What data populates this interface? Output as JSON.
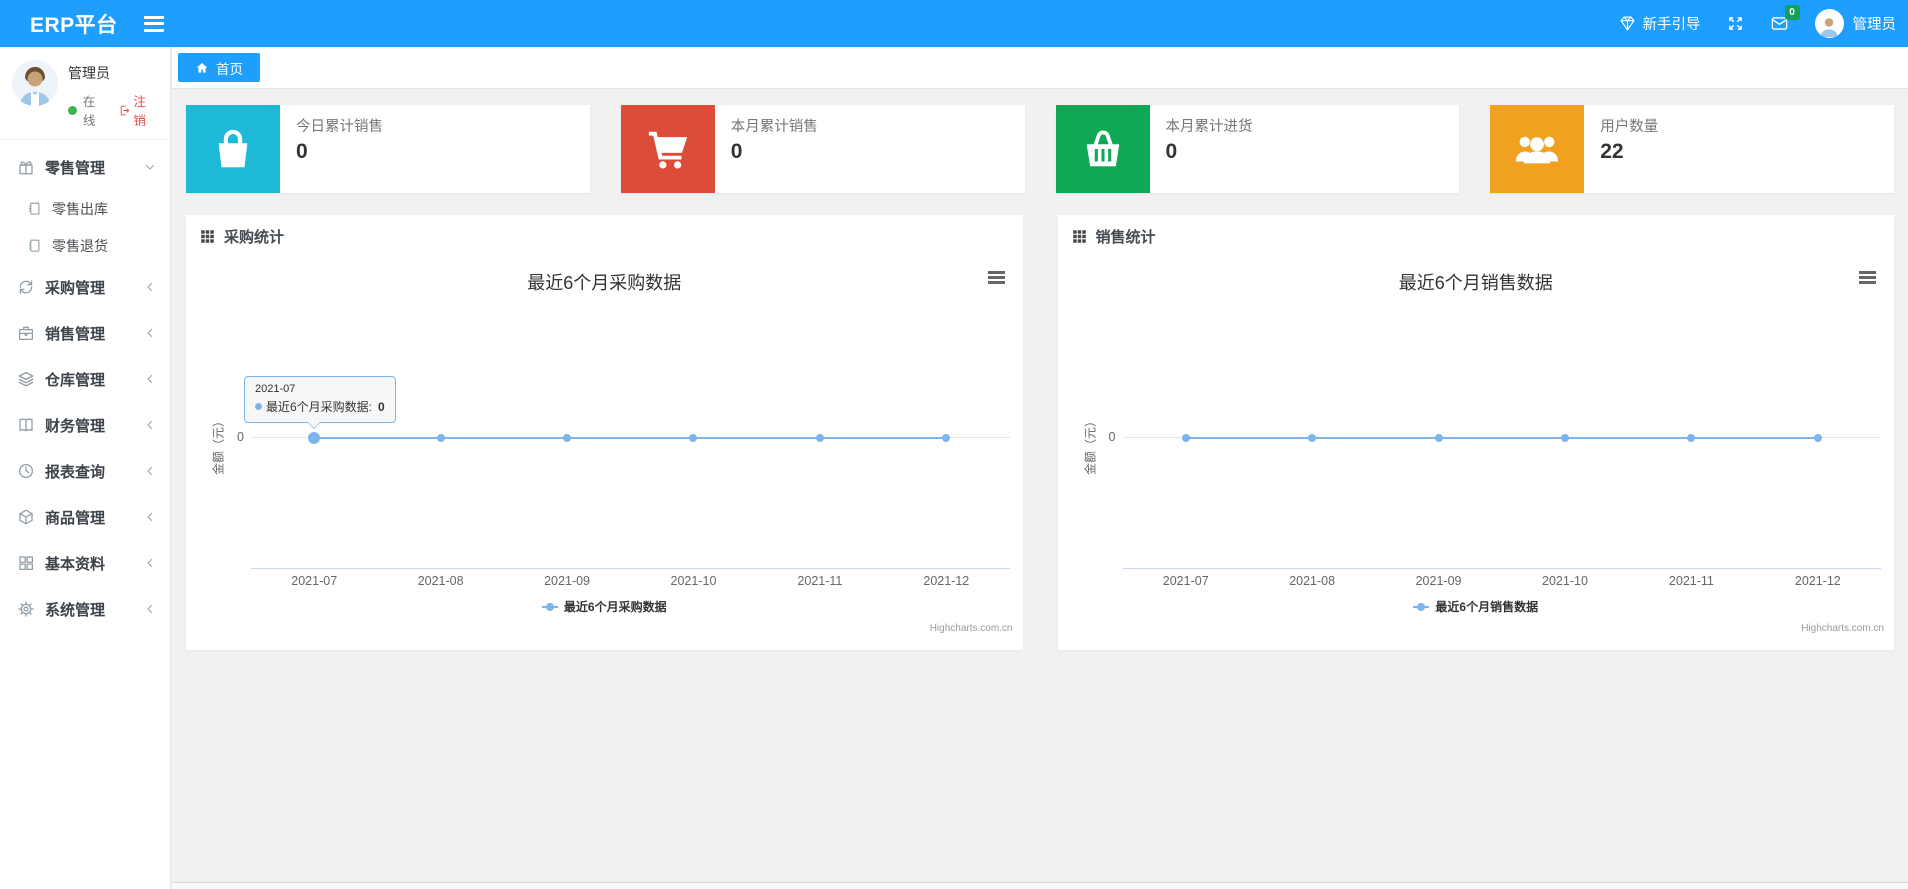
{
  "navbar": {
    "brand": "ERP平台",
    "menu_icon": "hamburger-icon",
    "right": {
      "guide_label": "新手引导",
      "guide_icon": "gem-icon",
      "fullscreen_icon": "fullscreen-icon",
      "mail_icon": "envelope-icon",
      "mail_badge": "0",
      "avatar_icon": "user-avatar",
      "username": "管理员"
    }
  },
  "sidebar": {
    "user": {
      "name": "管理员",
      "status_dot_color": "#3cb649",
      "status": "在线",
      "logout_icon": "logout-icon",
      "logout": "注销"
    },
    "menu": [
      {
        "label": "零售管理",
        "icon": "gift-icon",
        "state": "expanded",
        "children": [
          {
            "label": "零售出库",
            "icon": "notebook-icon"
          },
          {
            "label": "零售退货",
            "icon": "notebook-icon"
          }
        ]
      },
      {
        "label": "采购管理",
        "icon": "repeat-icon",
        "state": "collapsed"
      },
      {
        "label": "销售管理",
        "icon": "briefcase-icon",
        "state": "collapsed"
      },
      {
        "label": "仓库管理",
        "icon": "layers-icon",
        "state": "collapsed"
      },
      {
        "label": "财务管理",
        "icon": "open-book-icon",
        "state": "collapsed"
      },
      {
        "label": "报表查询",
        "icon": "clock-icon",
        "state": "collapsed"
      },
      {
        "label": "商品管理",
        "icon": "cube-icon",
        "state": "collapsed"
      },
      {
        "label": "基本资料",
        "icon": "grid-icon",
        "state": "collapsed"
      },
      {
        "label": "系统管理",
        "icon": "gear-icon",
        "state": "collapsed"
      }
    ]
  },
  "tabs": {
    "home": {
      "icon": "home-icon",
      "label": "首页"
    }
  },
  "stat_cards": [
    {
      "label": "今日累计销售",
      "value": "0",
      "color": "#1fb9d8",
      "icon": "shopping-bag-icon"
    },
    {
      "label": "本月累计销售",
      "value": "0",
      "color": "#dd4b39",
      "icon": "cart-icon"
    },
    {
      "label": "本月累计进货",
      "value": "0",
      "color": "#0fa956",
      "icon": "basket-icon"
    },
    {
      "label": "用户数量",
      "value": "22",
      "color": "#f0a11f",
      "icon": "users-icon"
    }
  ],
  "panels": [
    {
      "icon": "th-grid-icon",
      "title": "采购统计",
      "menu_icon": "chart-context-menu-icon"
    },
    {
      "icon": "th-grid-icon",
      "title": "销售统计",
      "menu_icon": "chart-context-menu-icon"
    }
  ],
  "chart_data": [
    {
      "type": "line",
      "title": "最近6个月采购数据",
      "categories": [
        "2021-07",
        "2021-08",
        "2021-09",
        "2021-10",
        "2021-11",
        "2021-12"
      ],
      "series": [
        {
          "name": "最近6个月采购数据",
          "values": [
            0,
            0,
            0,
            0,
            0,
            0
          ],
          "color": "#7cb5ec"
        }
      ],
      "xlabel": "",
      "ylabel": "金额（元）",
      "y_ticks": [
        "0"
      ],
      "ylim": [
        0,
        0
      ],
      "grid": true,
      "legend_position": "bottom",
      "credits": "Highcharts.com.cn",
      "tooltip": {
        "header": "2021-07",
        "series": "最近6个月采购数据:",
        "value": "0"
      }
    },
    {
      "type": "line",
      "title": "最近6个月销售数据",
      "categories": [
        "2021-07",
        "2021-08",
        "2021-09",
        "2021-10",
        "2021-11",
        "2021-12"
      ],
      "series": [
        {
          "name": "最近6个月销售数据",
          "values": [
            0,
            0,
            0,
            0,
            0,
            0
          ],
          "color": "#7cb5ec"
        }
      ],
      "xlabel": "",
      "ylabel": "金额（元）",
      "y_ticks": [
        "0"
      ],
      "ylim": [
        0,
        0
      ],
      "grid": true,
      "legend_position": "bottom",
      "credits": "Highcharts.com.cn"
    }
  ]
}
